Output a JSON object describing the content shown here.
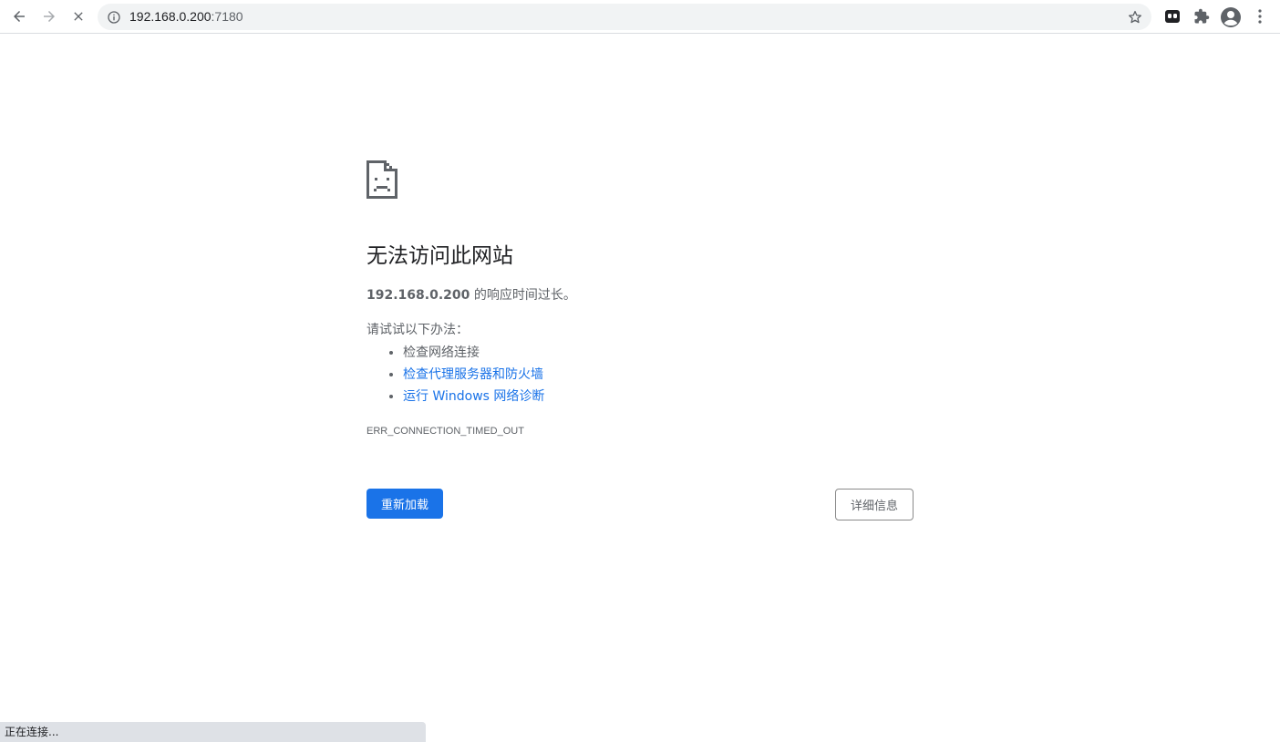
{
  "browser": {
    "url_host": "192.168.0.200",
    "url_port": ":7180",
    "icons": {
      "back": "back-arrow-icon",
      "forward": "forward-arrow-icon",
      "stop": "stop-loading-icon",
      "info": "info-icon",
      "star": "bookmark-star-icon",
      "extension_app": "extension-app-icon",
      "extensions": "puzzle-icon",
      "profile": "profile-avatar-icon",
      "menu": "kebab-menu-icon"
    }
  },
  "error_page": {
    "icon": "sad-file-icon",
    "title": "无法访问此网站",
    "host_bold": "192.168.0.200",
    "description_suffix": " 的响应时间过长。",
    "try_label": "请试试以下办法：",
    "suggestions": [
      {
        "text": "检查网络连接",
        "is_link": false
      },
      {
        "text": "检查代理服务器和防火墙",
        "is_link": true
      },
      {
        "text": "运行 Windows 网络诊断",
        "is_link": true
      }
    ],
    "error_code": "ERR_CONNECTION_TIMED_OUT",
    "reload_label": "重新加载",
    "details_label": "详细信息"
  },
  "status_bar": {
    "text": "正在连接..."
  },
  "colors": {
    "accent_blue": "#1a73e8",
    "text_gray": "#5f6368",
    "omnibox_bg": "#f1f3f4",
    "status_bg": "#dee1e6"
  }
}
